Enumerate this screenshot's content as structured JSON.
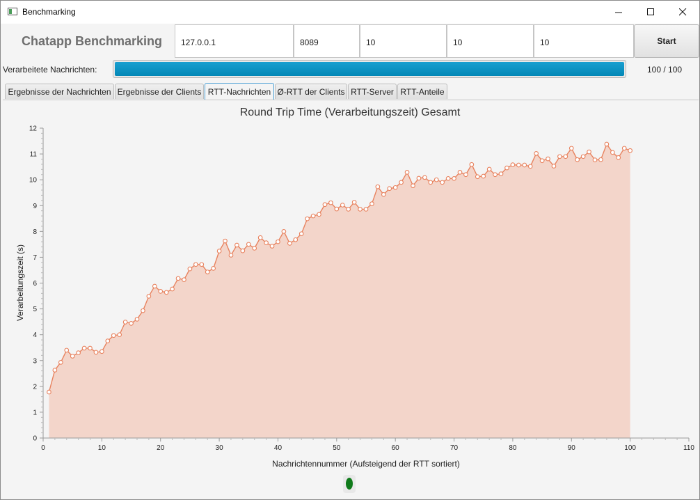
{
  "window": {
    "title": "Benchmarking"
  },
  "toolbar": {
    "heading": "Chatapp Benchmarking",
    "host": "127.0.0.1",
    "port": "8089",
    "field3": "10",
    "field4": "10",
    "field5": "10",
    "start_label": "Start"
  },
  "progress": {
    "label": "Verarbeitete Nachrichten:",
    "count_text": "100 / 100",
    "fraction": 1.0
  },
  "tabs": [
    {
      "label": "Ergebnisse der Nachrichten",
      "active": false
    },
    {
      "label": "Ergebnisse der Clients",
      "active": false
    },
    {
      "label": "RTT-Nachrichten",
      "active": true
    },
    {
      "label": "Ø-RTT der Clients",
      "active": false
    },
    {
      "label": "RTT-Server",
      "active": false
    },
    {
      "label": "RTT-Anteile",
      "active": false
    }
  ],
  "colors": {
    "accent": "#0a95c6",
    "series_line": "#e8825e",
    "series_fill": "#f3d5ca",
    "status": "#0f7a1a"
  },
  "chart_data": {
    "type": "area",
    "title": "Round Trip Time (Verarbeitungszeit) Gesamt",
    "xlabel": "Nachrichtennummer (Aufsteigend der RTT sortiert)",
    "ylabel": "Verarbeitungszeit (s)",
    "xlim": [
      0,
      110
    ],
    "ylim": [
      0,
      12
    ],
    "xticks": [
      0,
      10,
      20,
      30,
      40,
      50,
      60,
      70,
      80,
      90,
      100,
      110
    ],
    "yticks": [
      0,
      1,
      2,
      3,
      4,
      5,
      6,
      7,
      8,
      9,
      10,
      11,
      12
    ],
    "grid": false,
    "legend": "none",
    "x": [
      1,
      2,
      3,
      4,
      5,
      6,
      7,
      8,
      9,
      10,
      11,
      12,
      13,
      14,
      15,
      16,
      17,
      18,
      19,
      20,
      21,
      22,
      23,
      24,
      25,
      26,
      27,
      28,
      29,
      30,
      31,
      32,
      33,
      34,
      35,
      36,
      37,
      38,
      39,
      40,
      41,
      42,
      43,
      44,
      45,
      46,
      47,
      48,
      49,
      50,
      51,
      52,
      53,
      54,
      55,
      56,
      57,
      58,
      59,
      60,
      61,
      62,
      63,
      64,
      65,
      66,
      67,
      68,
      69,
      70,
      71,
      72,
      73,
      74,
      75,
      76,
      77,
      78,
      79,
      80,
      81,
      82,
      83,
      84,
      85,
      86,
      87,
      88,
      89,
      90,
      91,
      92,
      93,
      94,
      95,
      96,
      97,
      98,
      99,
      100
    ],
    "values": [
      1.78,
      2.63,
      2.93,
      3.4,
      3.17,
      3.3,
      3.48,
      3.48,
      3.32,
      3.35,
      3.76,
      3.97,
      4.0,
      4.49,
      4.44,
      4.6,
      4.93,
      5.49,
      5.88,
      5.68,
      5.64,
      5.77,
      6.18,
      6.13,
      6.55,
      6.72,
      6.72,
      6.43,
      6.57,
      7.24,
      7.63,
      7.08,
      7.47,
      7.25,
      7.5,
      7.35,
      7.76,
      7.56,
      7.43,
      7.6,
      8.0,
      7.54,
      7.68,
      7.91,
      8.49,
      8.6,
      8.66,
      9.04,
      9.11,
      8.87,
      9.02,
      8.86,
      9.13,
      8.86,
      8.86,
      9.07,
      9.73,
      9.43,
      9.66,
      9.7,
      9.9,
      10.29,
      9.77,
      10.06,
      10.09,
      9.9,
      10.0,
      9.9,
      10.05,
      10.05,
      10.29,
      10.2,
      10.59,
      10.12,
      10.14,
      10.41,
      10.2,
      10.23,
      10.46,
      10.58,
      10.57,
      10.57,
      10.52,
      11.02,
      10.74,
      10.81,
      10.53,
      10.9,
      10.9,
      11.22,
      10.78,
      10.9,
      11.08,
      10.77,
      10.78,
      11.38,
      11.06,
      10.86,
      11.22,
      11.13
    ]
  }
}
